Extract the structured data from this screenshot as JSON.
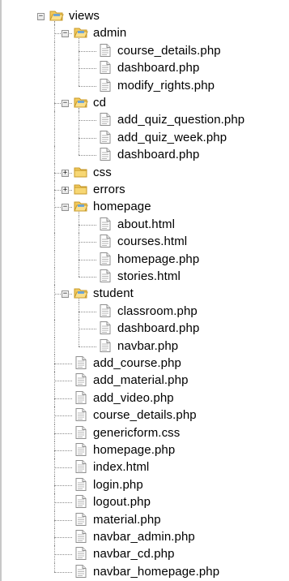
{
  "icons": {
    "folder": "folder-icon",
    "file": "file-icon",
    "expand": "plus-box-icon",
    "collapse": "minus-box-icon"
  },
  "colors": {
    "folder_fill": "#f2c95c",
    "folder_edge": "#c79a2a",
    "guide": "#8c8c8c"
  },
  "tree": [
    {
      "label": "views",
      "kind": "folder",
      "expanded": true,
      "children": [
        {
          "label": "admin",
          "kind": "folder",
          "expanded": true,
          "children": [
            {
              "label": "course_details.php",
              "kind": "file"
            },
            {
              "label": "dashboard.php",
              "kind": "file"
            },
            {
              "label": "modify_rights.php",
              "kind": "file"
            }
          ]
        },
        {
          "label": "cd",
          "kind": "folder",
          "expanded": true,
          "children": [
            {
              "label": "add_quiz_question.php",
              "kind": "file"
            },
            {
              "label": "add_quiz_week.php",
              "kind": "file"
            },
            {
              "label": "dashboard.php",
              "kind": "file"
            }
          ]
        },
        {
          "label": "css",
          "kind": "folder",
          "expanded": false,
          "children": []
        },
        {
          "label": "errors",
          "kind": "folder",
          "expanded": false,
          "children": []
        },
        {
          "label": "homepage",
          "kind": "folder",
          "expanded": true,
          "children": [
            {
              "label": "about.html",
              "kind": "file"
            },
            {
              "label": "courses.html",
              "kind": "file"
            },
            {
              "label": "homepage.php",
              "kind": "file"
            },
            {
              "label": "stories.html",
              "kind": "file"
            }
          ]
        },
        {
          "label": "student",
          "kind": "folder",
          "expanded": true,
          "children": [
            {
              "label": "classroom.php",
              "kind": "file"
            },
            {
              "label": "dashboard.php",
              "kind": "file"
            },
            {
              "label": "navbar.php",
              "kind": "file"
            }
          ]
        },
        {
          "label": "add_course.php",
          "kind": "file"
        },
        {
          "label": "add_material.php",
          "kind": "file"
        },
        {
          "label": "add_video.php",
          "kind": "file"
        },
        {
          "label": "course_details.php",
          "kind": "file"
        },
        {
          "label": "genericform.css",
          "kind": "file"
        },
        {
          "label": "homepage.php",
          "kind": "file"
        },
        {
          "label": "index.html",
          "kind": "file"
        },
        {
          "label": "login.php",
          "kind": "file"
        },
        {
          "label": "logout.php",
          "kind": "file"
        },
        {
          "label": "material.php",
          "kind": "file"
        },
        {
          "label": "navbar_admin.php",
          "kind": "file"
        },
        {
          "label": "navbar_cd.php",
          "kind": "file"
        },
        {
          "label": "navbar_homepage.php",
          "kind": "file"
        }
      ]
    }
  ]
}
